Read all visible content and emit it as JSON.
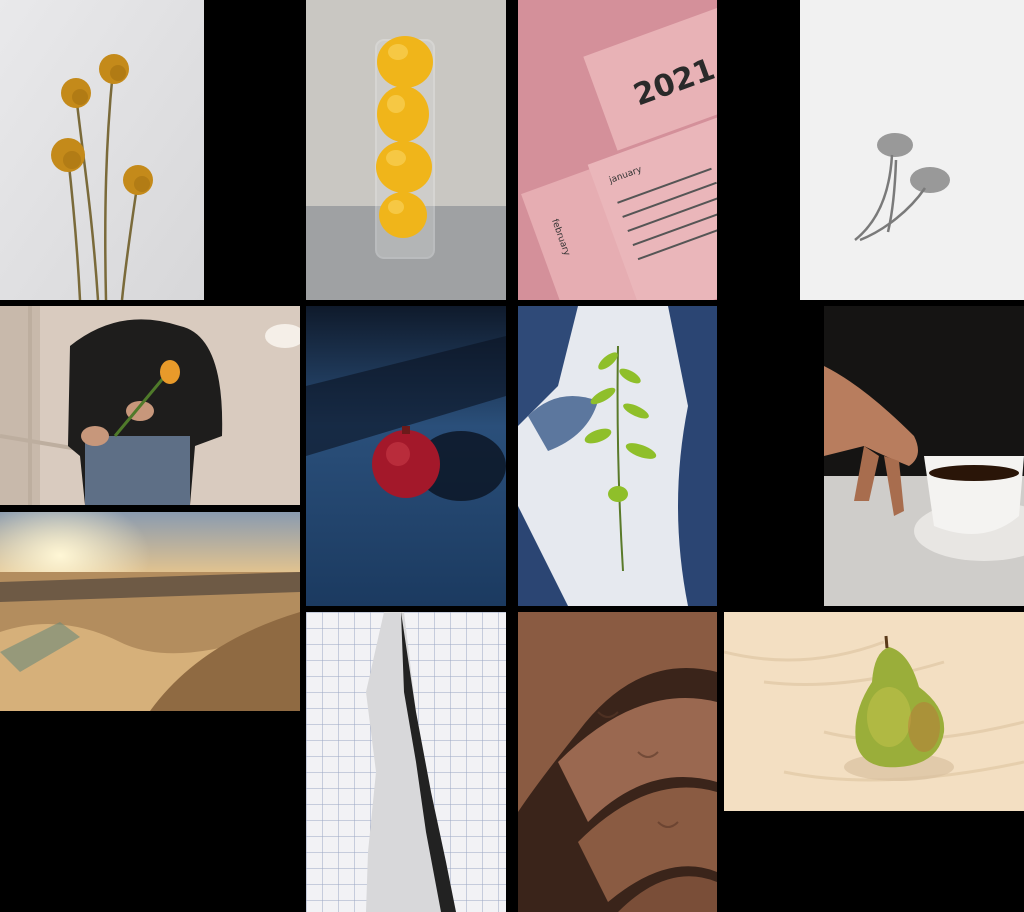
{
  "gallery": {
    "background": "#000000",
    "tiles": [
      {
        "name": "billy-buttons-flowers",
        "alt": "Yellow billy button flowers on grey"
      },
      {
        "name": "lemons-in-glass",
        "alt": "Lemons stacked in a tall glass"
      },
      {
        "name": "pink-calendar",
        "alt": "Pink calendar cards"
      },
      {
        "name": "flower-shadow",
        "alt": "Flowers casting a shadow on white"
      },
      {
        "name": "woman-with-rose",
        "alt": "Person in black blouse holding a rose"
      },
      {
        "name": "pomegranate",
        "alt": "Pomegranate on blue surface in shadow"
      },
      {
        "name": "leaf-sprig",
        "alt": "Green sprig with hand shadow"
      },
      {
        "name": "coffee-cup",
        "alt": "Hand reaching for a cup of coffee"
      },
      {
        "name": "desert-dunes",
        "alt": "Sand dunes at sunset"
      },
      {
        "name": "torn-grid-paper",
        "alt": "Torn grid paper"
      },
      {
        "name": "hand-closeup",
        "alt": "Close-up of hands"
      },
      {
        "name": "pear",
        "alt": "Green and red pear with leaf shadows"
      }
    ]
  },
  "calendar": {
    "year": "2021",
    "month1": "january",
    "month2": "february",
    "sub": "2021"
  }
}
